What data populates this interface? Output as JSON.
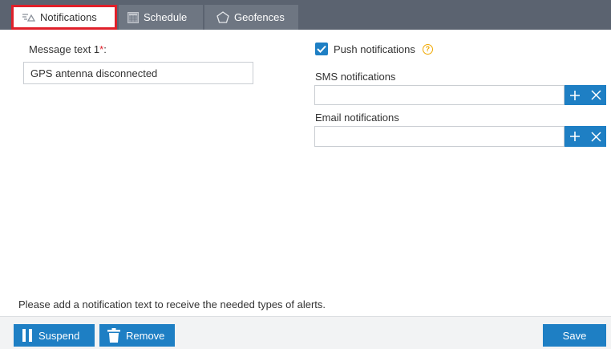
{
  "tabs": [
    {
      "label": "Notifications",
      "icon": "envelope-icon",
      "active": true
    },
    {
      "label": "Schedule",
      "icon": "calendar-icon",
      "active": false
    },
    {
      "label": "Geofences",
      "icon": "pentagon-icon",
      "active": false
    }
  ],
  "left": {
    "message_label": "Message text 1",
    "required_mark": "*",
    "label_colon": ":",
    "message_value": "GPS antenna disconnected"
  },
  "right": {
    "push_label": "Push notifications",
    "push_checked": true,
    "help_glyph": "?",
    "sms_label": "SMS notifications",
    "sms_value": "",
    "email_label": "Email notifications",
    "email_value": ""
  },
  "hint": "Please add a notification text to receive the needed types of alerts.",
  "footer": {
    "suspend_label": "Suspend",
    "remove_label": "Remove",
    "save_label": "Save"
  },
  "colors": {
    "accent": "#1e7fc4",
    "tabbar": "#5b6370",
    "active_tab_border": "#e0202a",
    "help": "#f0a800"
  }
}
